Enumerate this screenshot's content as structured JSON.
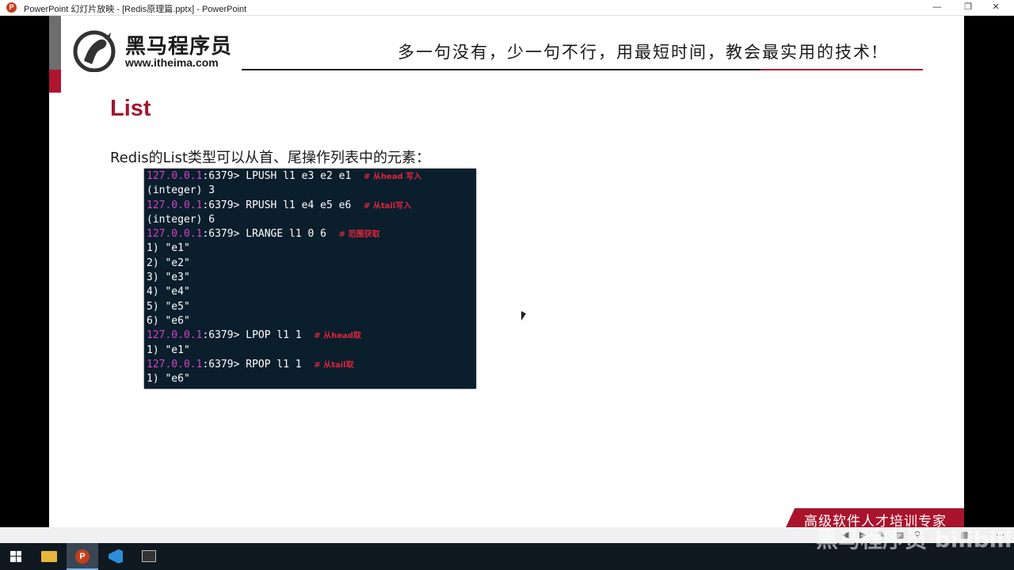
{
  "window": {
    "title": "PowerPoint 幻灯片放映 - [Redis原理篇.pptx] - PowerPoint",
    "app_icon_letter": "P"
  },
  "slide": {
    "logo": {
      "name_cn": "黑马程序员",
      "url": "www.itheima.com"
    },
    "slogan": "多一句没有，少一句不行，用最短时间，教会最实用的技术!",
    "heading": "List",
    "description": "Redis的List类型可以从首、尾操作列表中的元素：",
    "terminal_lines": [
      {
        "ip": "127.0.0.1",
        "rest": ":6379> LPUSH l1 e3 e2 e1",
        "comment": "# 从head 写入"
      },
      {
        "ip": "",
        "rest": "(integer) 3",
        "comment": ""
      },
      {
        "ip": "127.0.0.1",
        "rest": ":6379> RPUSH l1 e4 e5 e6",
        "comment": "# 从tail写入"
      },
      {
        "ip": "",
        "rest": "(integer) 6",
        "comment": ""
      },
      {
        "ip": "127.0.0.1",
        "rest": ":6379> LRANGE l1 0 6",
        "comment": "# 范围获取"
      },
      {
        "ip": "",
        "rest": "1) \"e1\"",
        "comment": ""
      },
      {
        "ip": "",
        "rest": "2) \"e2\"",
        "comment": ""
      },
      {
        "ip": "",
        "rest": "3) \"e3\"",
        "comment": ""
      },
      {
        "ip": "",
        "rest": "4) \"e4\"",
        "comment": ""
      },
      {
        "ip": "",
        "rest": "5) \"e5\"",
        "comment": ""
      },
      {
        "ip": "",
        "rest": "6) \"e6\"",
        "comment": ""
      },
      {
        "ip": "127.0.0.1",
        "rest": ":6379> LPOP l1 1",
        "comment": "# 从head取"
      },
      {
        "ip": "",
        "rest": "1) \"e1\"",
        "comment": ""
      },
      {
        "ip": "127.0.0.1",
        "rest": ":6379> RPOP l1 1",
        "comment": "# 从tail取"
      },
      {
        "ip": "",
        "rest": "1) \"e6\"",
        "comment": ""
      }
    ],
    "footer": "高级软件人才培训专家"
  },
  "colors": {
    "brand_red": "#b0152f",
    "terminal_bg": "#0a1e2c",
    "ip_color": "#d142c6",
    "comment_color": "#e0243c"
  },
  "watermark": "黑马程序员 bilibili",
  "taskbar": {
    "items": [
      "windows-start-icon",
      "file-explorer-icon",
      "powerpoint-icon",
      "vscode-icon",
      "terminal-icon"
    ]
  }
}
